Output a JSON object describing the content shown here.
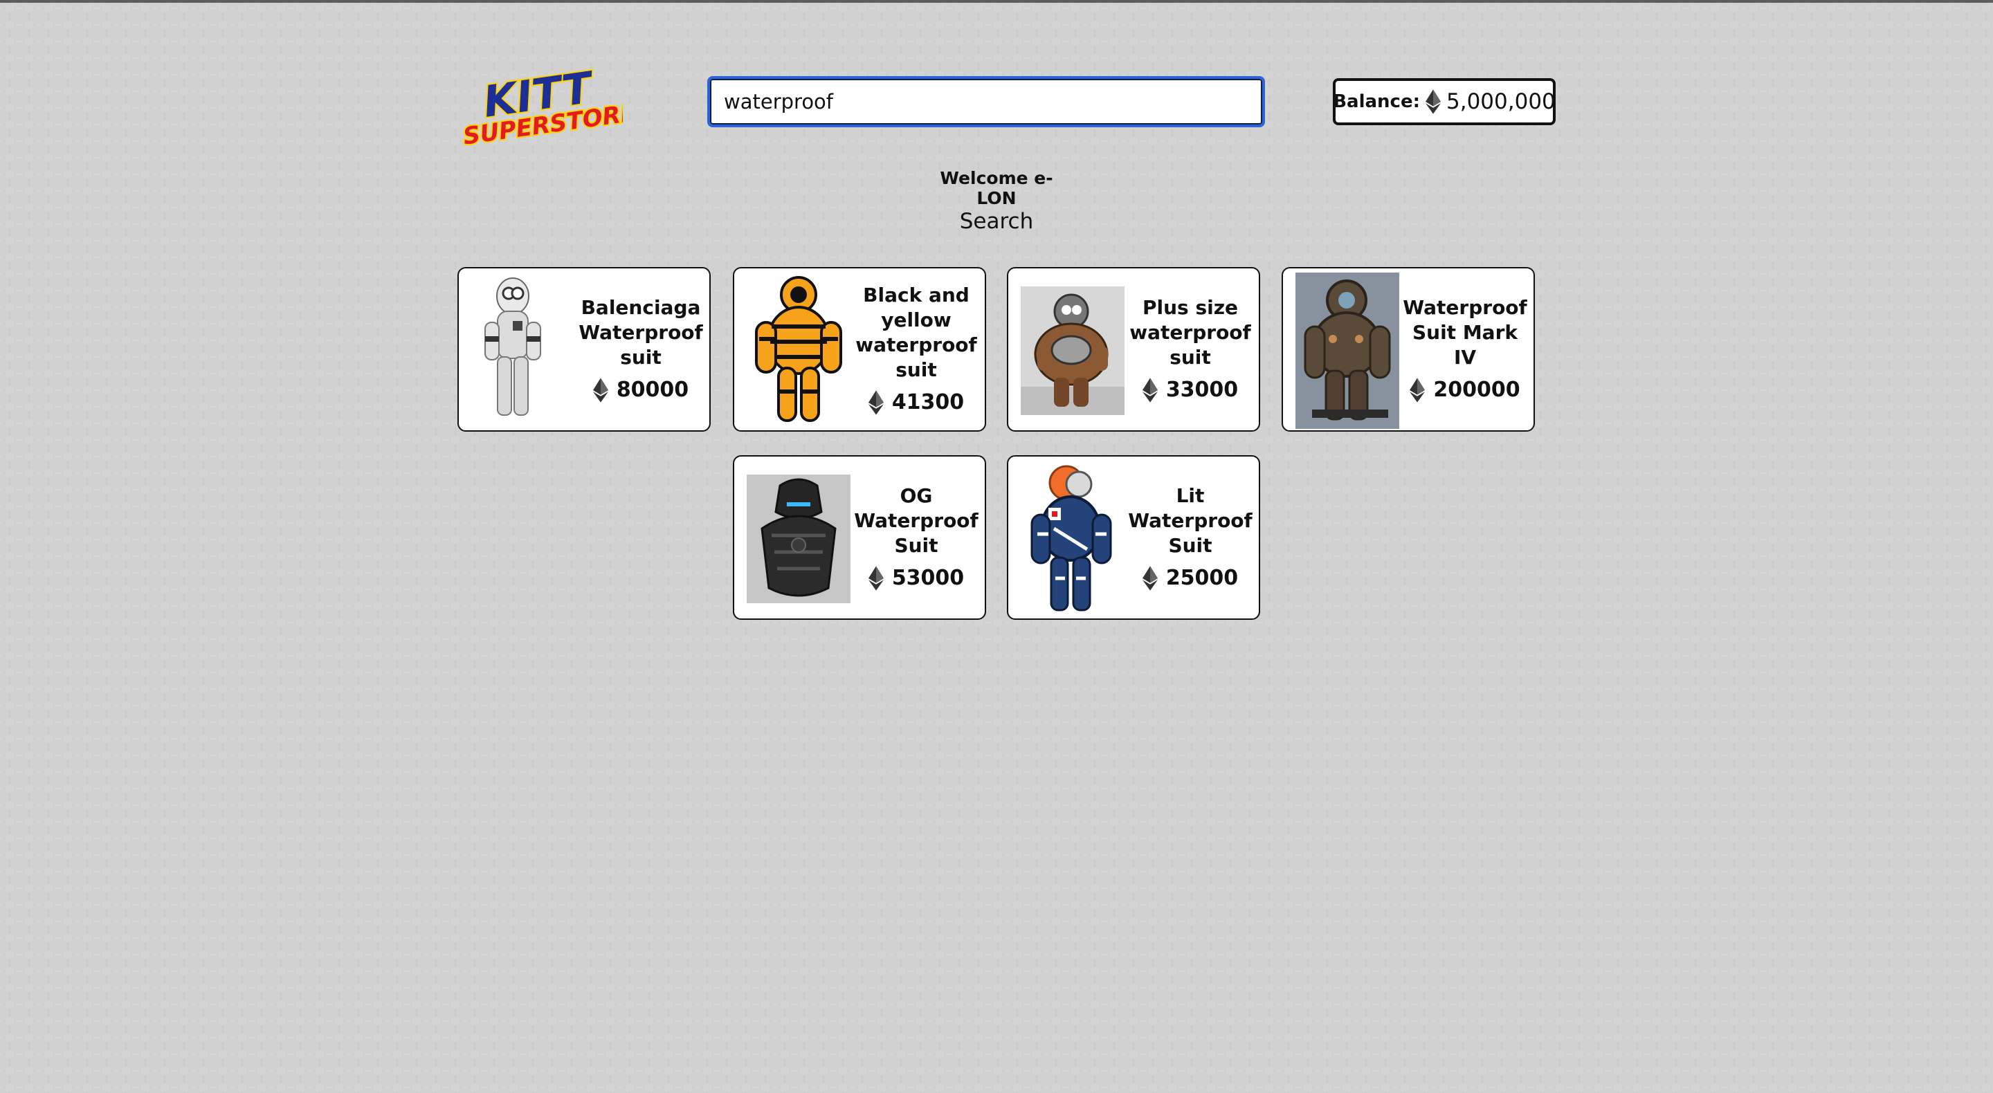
{
  "app": {
    "logo_text": "KITT SUPERSTORE"
  },
  "search": {
    "value": "waterproof",
    "placeholder": ""
  },
  "balance": {
    "label": "Balance:",
    "amount": "5,000,000",
    "currency_icon": "ethereum-icon"
  },
  "welcome": {
    "text": "Welcome e-LON"
  },
  "page": {
    "heading": "Search"
  },
  "products": [
    {
      "name": "Balenciaga Waterproof suit",
      "price": "80000",
      "currency_icon": "ethereum-icon",
      "image": "white-suit-image",
      "color": "#d9d9d9"
    },
    {
      "name": "Black and yellow waterproof suit",
      "price": "41300",
      "currency_icon": "ethereum-icon",
      "image": "yellow-suit-image",
      "color": "#f7a21b"
    },
    {
      "name": "Plus size waterproof suit",
      "price": "33000",
      "currency_icon": "ethereum-icon",
      "image": "brown-suit-image",
      "color": "#8b5a35"
    },
    {
      "name": "Waterproof Suit Mark IV",
      "price": "200000",
      "currency_icon": "ethereum-icon",
      "image": "diving-suit-image",
      "color": "#5a4a38"
    },
    {
      "name": "OG Waterproof Suit",
      "price": "53000",
      "currency_icon": "ethereum-icon",
      "image": "black-armor-suit-image",
      "color": "#252525"
    },
    {
      "name": "Lit Waterproof Suit",
      "price": "25000",
      "currency_icon": "ethereum-icon",
      "image": "blue-suit-image",
      "color": "#24437a"
    }
  ],
  "colors": {
    "focus_border": "#2d63d6",
    "card_border": "#111111",
    "logo_blue": "#1d2f96",
    "logo_red": "#e21b23",
    "logo_yellow": "#ffd400"
  }
}
